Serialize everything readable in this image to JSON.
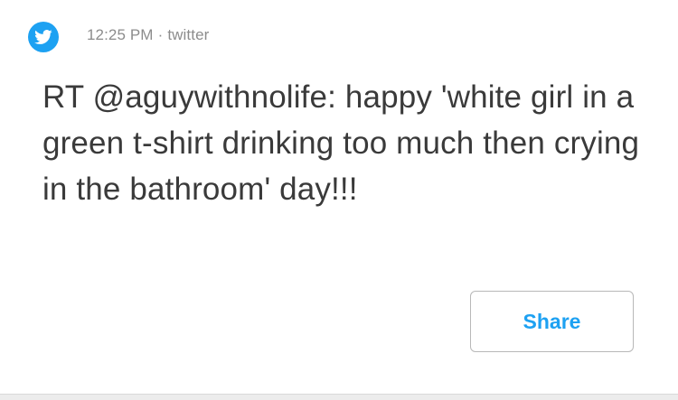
{
  "tweet": {
    "time": "12:25 PM",
    "separator": "·",
    "source": "twitter",
    "text": "RT @aguywithnolife: happy 'white girl in a green t-shirt drinking too much then crying in the bathroom' day!!!"
  },
  "actions": {
    "share_label": "Share"
  },
  "icons": {
    "source_icon": "twitter-bird-icon"
  },
  "colors": {
    "accent": "#1da1f2",
    "text": "#3a3a3a",
    "meta": "#8c8c8c",
    "button_border": "#b8b8b8"
  }
}
